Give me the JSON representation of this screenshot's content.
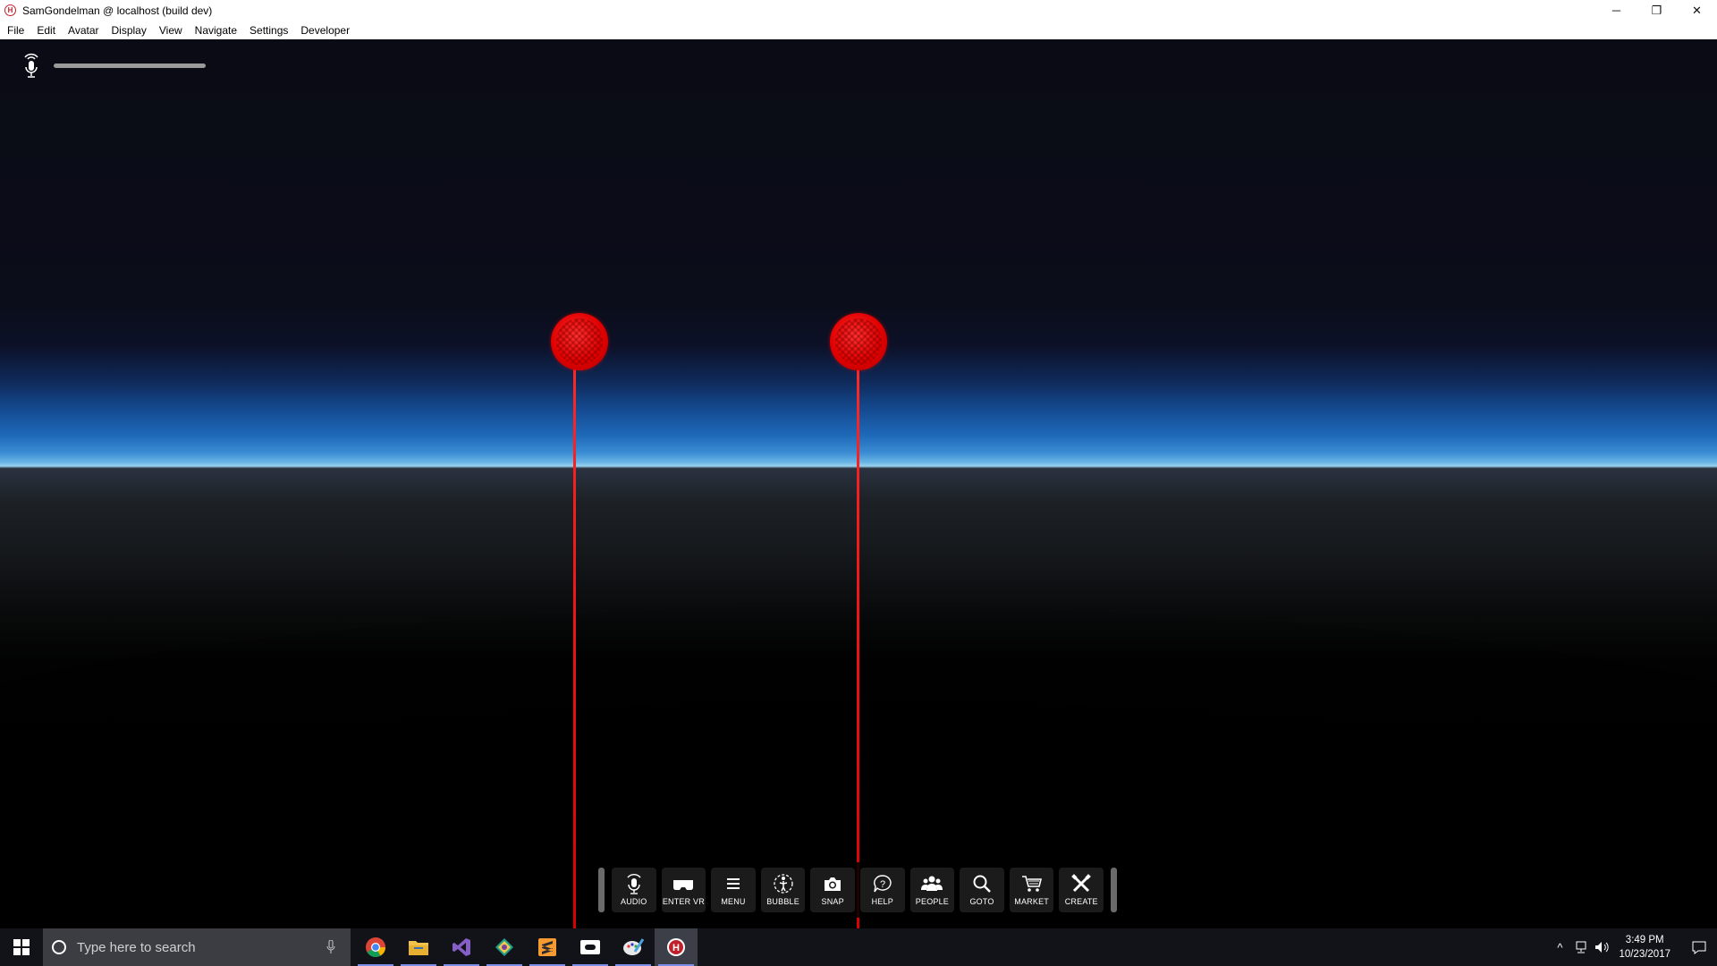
{
  "window": {
    "title": "SamGondelman @ localhost (build dev)",
    "app_icon": "H",
    "controls": [
      "minimize",
      "restore",
      "close"
    ],
    "minimize_glyph": "─",
    "restore_glyph": "❐",
    "close_glyph": "✕"
  },
  "menu": [
    "File",
    "Edit",
    "Avatar",
    "Display",
    "View",
    "Navigate",
    "Settings",
    "Developer"
  ],
  "hud": {
    "audio_icon": "mic-icon",
    "level_bar": "input-level-meter"
  },
  "lasers": [
    {
      "name": "left-hand-laser",
      "color": "#ff0000"
    },
    {
      "name": "right-hand-laser",
      "color": "#ff0000"
    }
  ],
  "toolbar": {
    "buttons": [
      {
        "label": "AUDIO",
        "icon": "mic-icon"
      },
      {
        "label": "ENTER VR",
        "icon": "vr-headset-icon"
      },
      {
        "label": "MENU",
        "icon": "hamburger-icon"
      },
      {
        "label": "BUBBLE",
        "icon": "bubble-icon"
      },
      {
        "label": "SNAP",
        "icon": "camera-icon"
      },
      {
        "label": "HELP",
        "icon": "help-icon"
      },
      {
        "label": "PEOPLE",
        "icon": "people-icon"
      },
      {
        "label": "GOTO",
        "icon": "search-icon"
      },
      {
        "label": "MARKET",
        "icon": "cart-icon"
      },
      {
        "label": "CREATE",
        "icon": "tools-icon"
      }
    ]
  },
  "taskbar": {
    "search_placeholder": "Type here to search",
    "apps": [
      "chrome-icon",
      "file-explorer-icon",
      "visual-studio-icon",
      "gitkraken-icon",
      "sublime-text-icon",
      "oculus-icon",
      "paint-icon",
      "high-fidelity-icon"
    ],
    "time": "3:49 PM",
    "date": "10/23/2017",
    "tray_chevron": "^"
  }
}
